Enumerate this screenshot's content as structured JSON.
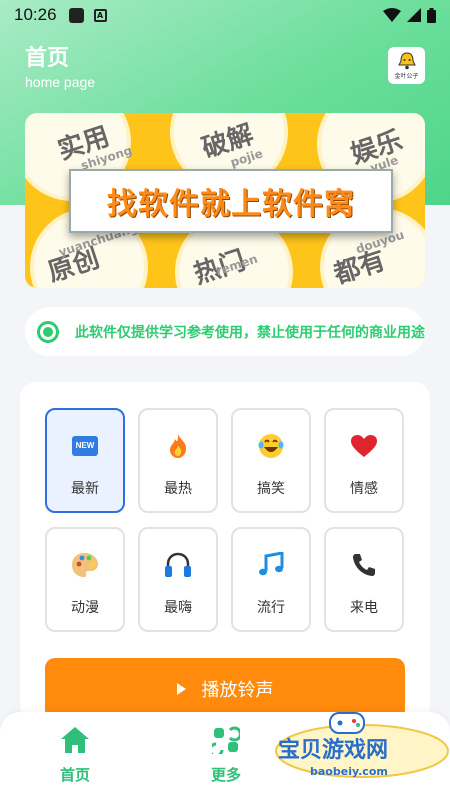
{
  "status_bar": {
    "time": "10:26"
  },
  "header": {
    "title": "首页",
    "subtitle": "home page",
    "avatar_text": "金叶公子"
  },
  "banner": {
    "headline": "找软件就上软件窝",
    "tiles": [
      {
        "cn": "实用",
        "py": "shiyong"
      },
      {
        "cn": "破解",
        "py": "pojie"
      },
      {
        "cn": "娱乐",
        "py": "yule"
      },
      {
        "cn": "原创",
        "py": "yuanchuang"
      },
      {
        "cn": "热门",
        "py": "remen"
      },
      {
        "cn": "都有",
        "py": "douyou"
      }
    ]
  },
  "notice": {
    "text": "此软件仅提供学习参考使用，禁止使用于任何的商业用途"
  },
  "categories": [
    {
      "label": "最新",
      "icon": "new-icon",
      "selected": true
    },
    {
      "label": "最热",
      "icon": "fire-icon",
      "selected": false
    },
    {
      "label": "搞笑",
      "icon": "laugh-icon",
      "selected": false
    },
    {
      "label": "情感",
      "icon": "heart-icon",
      "selected": false
    },
    {
      "label": "动漫",
      "icon": "palette-icon",
      "selected": false
    },
    {
      "label": "最嗨",
      "icon": "headphones-icon",
      "selected": false
    },
    {
      "label": "流行",
      "icon": "music-note-icon",
      "selected": false
    },
    {
      "label": "来电",
      "icon": "phone-icon",
      "selected": false
    }
  ],
  "new_badge": "NEW",
  "play_button": {
    "label": "播放铃声"
  },
  "bottom_nav": [
    {
      "label": "首页",
      "icon": "home-icon"
    },
    {
      "label": "更多",
      "icon": "more-icon"
    }
  ],
  "watermark": {
    "cn": "宝贝游戏网",
    "url": "baobeiy.com"
  },
  "colors": {
    "accent_green": "#2fbf7a",
    "play_orange": "#ff8a0c",
    "selected_blue": "#2f6fe0",
    "banner_yellow": "#ffc41a"
  }
}
